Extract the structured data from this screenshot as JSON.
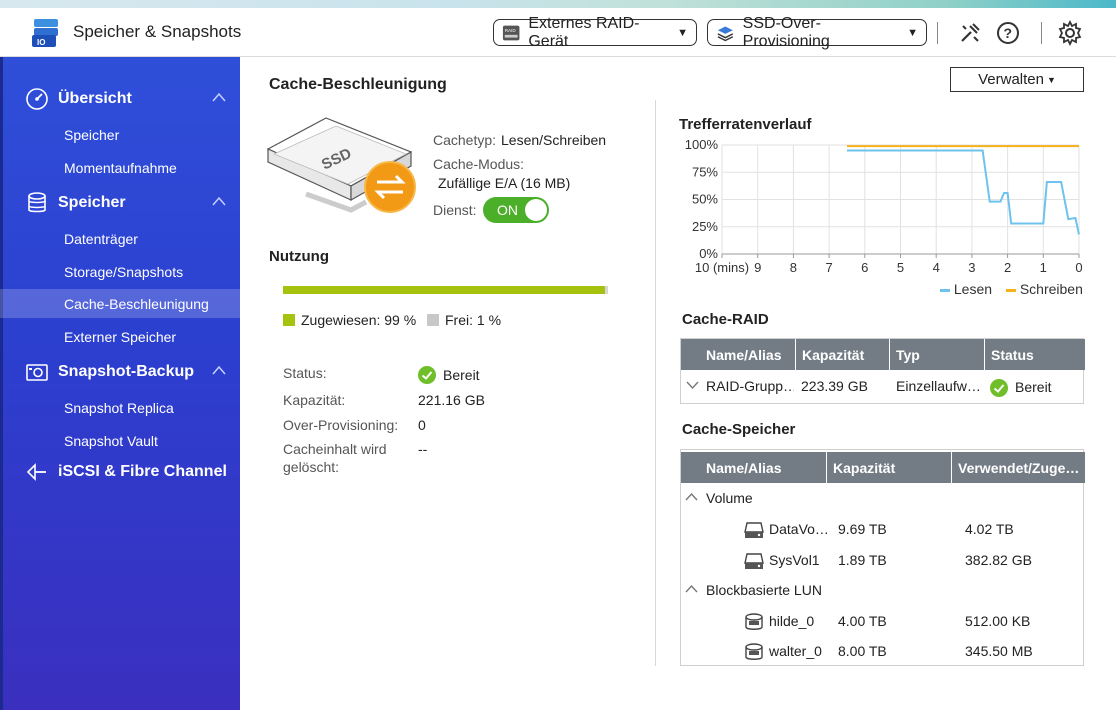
{
  "header": {
    "title": "Speicher & Snapshots",
    "dropdown_raid": "Externes RAID-Gerät",
    "dropdown_ssd": "SSD-Over-Provisioning",
    "raid_icon_text": "RAID"
  },
  "sidebar": {
    "uebersicht": "Übersicht",
    "uebersicht_items": [
      "Speicher",
      "Momentaufnahme"
    ],
    "speicher": "Speicher",
    "speicher_items": [
      "Datenträger",
      "Storage/Snapshots",
      "Cache-Beschleunigung",
      "Externer Speicher"
    ],
    "snapshot_backup": "Snapshot-Backup",
    "snapshot_items": [
      "Snapshot Replica",
      "Snapshot Vault"
    ],
    "iscsi": "iSCSI & Fibre Channel"
  },
  "main": {
    "title": "Cache-Beschleunigung",
    "manage_button": "Verwalten",
    "cachetype_label": "Cachetyp:",
    "cachetype_value": "Lesen/Schreiben",
    "cachemode_label": "Cache-Modus:",
    "cachemode_value": "Zufällige E/A (16 MB)",
    "service_label": "Dienst:",
    "service_toggle": "ON",
    "ssd_label": "SSD",
    "usage_title": "Nutzung",
    "usage_allocated_pct": 99,
    "legend_allocated": "Zugewiesen: 99 %",
    "legend_free": "Frei: 1 %",
    "status_label": "Status:",
    "status_value": "Bereit",
    "capacity_label": "Kapazität:",
    "capacity_value": "221.16 GB",
    "overprov_label": "Over-Provisioning:",
    "overprov_value": "0",
    "flush_label_1": "Cacheinhalt wird",
    "flush_label_2": "gelöscht:",
    "flush_value": "--"
  },
  "colors": {
    "sidebar": "#2f4fd9",
    "toggle_on": "#4caf2a",
    "usage_fill": "#a6c20f",
    "read": "#6ec3ee",
    "write": "#f5b21a",
    "table_header": "#737c85",
    "ok": "#6fbf2a"
  },
  "chart_data": {
    "type": "line",
    "title": "Trefferratenverlauf",
    "xlabel": "",
    "ylabel": "",
    "x_ticks": [
      "10 (mins)",
      "9",
      "8",
      "7",
      "6",
      "5",
      "4",
      "3",
      "2",
      "1",
      "0"
    ],
    "y_ticks": [
      "100%",
      "75%",
      "50%",
      "25%",
      "0%"
    ],
    "ylim": [
      0,
      100
    ],
    "xlim": [
      10,
      0
    ],
    "legend": "bottom-right",
    "grid": true,
    "series": [
      {
        "name": "Lesen",
        "color": "#6ec3ee",
        "x": [
          6.5,
          3.0,
          2.7,
          2.5,
          2.2,
          2.1,
          2.0,
          1.9,
          1.0,
          0.9,
          0.5,
          0.3,
          0.1,
          0.0
        ],
        "y": [
          95,
          95,
          95,
          48,
          48,
          56,
          56,
          28,
          28,
          66,
          66,
          32,
          33,
          18
        ]
      },
      {
        "name": "Schreiben",
        "color": "#f5b21a",
        "x": [
          6.5,
          5.0,
          4.0,
          3.0,
          2.0,
          1.0,
          0.0
        ],
        "y": [
          99,
          99,
          99,
          99,
          99,
          99,
          99
        ]
      }
    ]
  },
  "raid": {
    "title": "Cache-RAID",
    "headers": [
      "Name/Alias",
      "Kapazität",
      "Typ",
      "Status"
    ],
    "row": [
      "RAID-Grupp…",
      "223.39 GB",
      "Einzellaufw…",
      "Bereit"
    ]
  },
  "cache_storage": {
    "title": "Cache-Speicher",
    "headers": [
      "Name/Alias",
      "Kapazität",
      "Verwendet/Zuge…"
    ],
    "group_volume": "Volume",
    "group_lun": "Blockbasierte LUN",
    "rows": [
      {
        "name": "DataVo…",
        "capacity": "9.69 TB",
        "used": "4.02 TB"
      },
      {
        "name": "SysVol1",
        "capacity": "1.89 TB",
        "used": "382.82 GB"
      },
      {
        "name": "hilde_0",
        "capacity": "4.00 TB",
        "used": "512.00 KB"
      },
      {
        "name": "walter_0",
        "capacity": "8.00 TB",
        "used": "345.50 MB"
      }
    ]
  }
}
